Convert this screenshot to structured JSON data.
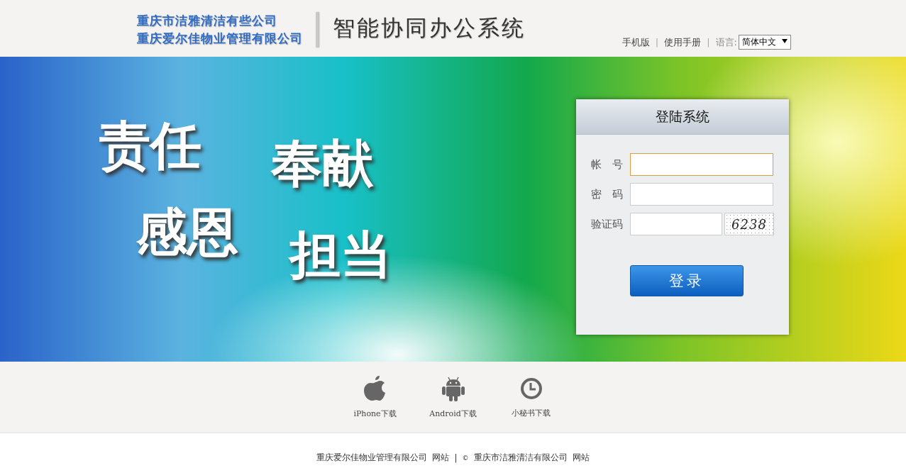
{
  "header": {
    "companies": [
      "重庆市洁雅清洁有些公司",
      "重庆爱尔佳物业管理有限公司"
    ],
    "system_title": "智能协同办公系统",
    "links": [
      "手机版",
      "使用手册"
    ],
    "separators": [
      "|",
      "|"
    ],
    "language_label": "语言:",
    "language_value": "简体中文"
  },
  "banner": {
    "slogans": [
      "责任",
      "奉献",
      "感恩",
      "担当"
    ]
  },
  "login": {
    "title": "登陆系统",
    "fields": [
      {
        "label": "帐　号",
        "kind": "text",
        "focused": true
      },
      {
        "label": "密　码",
        "kind": "password",
        "focused": false
      },
      {
        "label": "验证码",
        "kind": "captcha",
        "focused": false,
        "captcha": "6238"
      }
    ],
    "button": "登录"
  },
  "downloads": [
    {
      "kind": "apple",
      "label": "iPhone下载"
    },
    {
      "kind": "android",
      "label": "Android下载"
    },
    {
      "kind": "clock",
      "label": "小秘书下载"
    }
  ],
  "footer": {
    "company_1": "重庆爱尔佳物业管理有限公司",
    "link_1": "网站",
    "separator": "|",
    "copyright": "©",
    "company_2": "重庆市洁雅清洁有限公司",
    "link_2": "网站"
  }
}
